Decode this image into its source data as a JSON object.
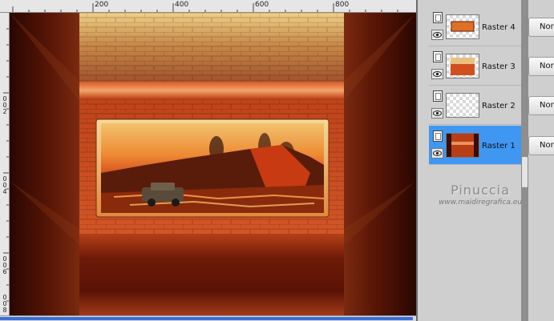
{
  "ruler": {
    "top_labels": [
      "200",
      "400",
      "600",
      "800"
    ],
    "left_labels": [
      "0",
      "0",
      "2",
      "0",
      "0",
      "4",
      "0",
      "0",
      "6",
      "0",
      "0",
      "8"
    ]
  },
  "layers": [
    {
      "name": "Raster 4",
      "blend": "Normal",
      "selected": false
    },
    {
      "name": "Raster 3",
      "blend": "Normal",
      "selected": false
    },
    {
      "name": "Raster 2",
      "blend": "Normal",
      "selected": false
    },
    {
      "name": "Raster 1",
      "blend": "Normal",
      "selected": true
    }
  ],
  "watermark": {
    "signature": "Pinuccia",
    "url": "www.maidiregrafica.eu"
  },
  "colors": {
    "workspace": "#4a6fa0",
    "selected_layer": "#3f97f2",
    "panel_bg": "#cfcfcf"
  },
  "icons": {
    "layer_type": "raster-layer-icon",
    "visibility": "eye-icon"
  }
}
